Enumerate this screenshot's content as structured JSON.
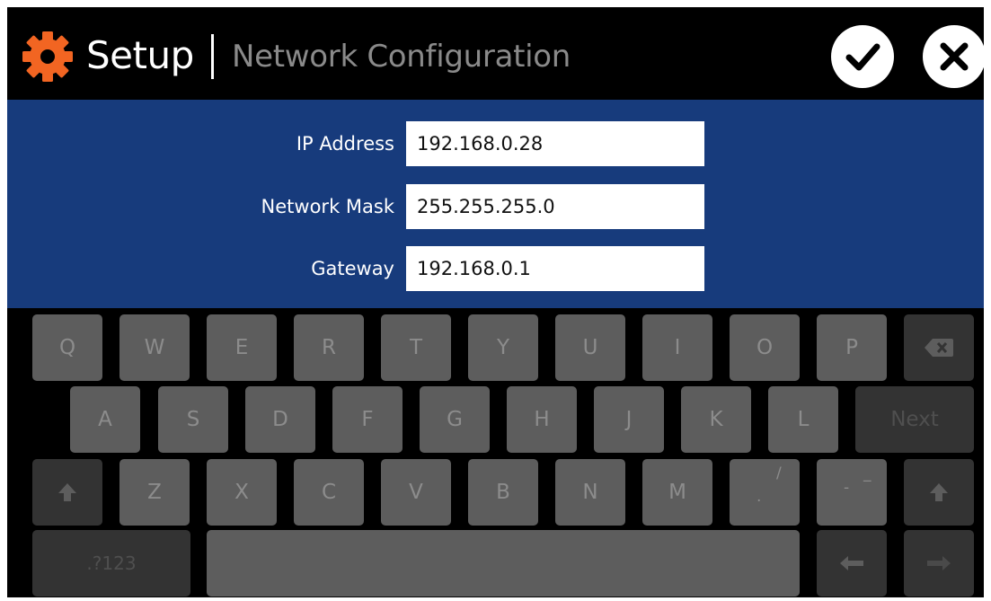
{
  "header": {
    "title": "Setup",
    "subtitle": "Network Configuration",
    "icon": "gear-icon",
    "accent_color": "#f26522",
    "confirm_icon": "checkmark-icon",
    "cancel_icon": "close-icon"
  },
  "form": {
    "background_color": "#173b7c",
    "fields": [
      {
        "label": "IP Address",
        "value": "192.168.0.28"
      },
      {
        "label": "Network Mask",
        "value": "255.255.255.0"
      },
      {
        "label": "Gateway",
        "value": "192.168.0.1"
      }
    ]
  },
  "keyboard": {
    "row1": [
      "Q",
      "W",
      "E",
      "R",
      "T",
      "Y",
      "U",
      "I",
      "O",
      "P"
    ],
    "row2": [
      "A",
      "S",
      "D",
      "F",
      "G",
      "H",
      "J",
      "K",
      "L"
    ],
    "row3": [
      "Z",
      "X",
      "C",
      "V",
      "B",
      "N",
      "M"
    ],
    "period_key": {
      "main": ".",
      "alt": "/"
    },
    "dash_key": {
      "main": "-",
      "alt": "_"
    },
    "next_label": "Next",
    "symbols_label": ".?123",
    "backspace_icon": "backspace-icon",
    "shift_icon": "shift-icon",
    "left_arrow_icon": "arrow-left-icon",
    "right_arrow_icon": "arrow-right-icon"
  }
}
